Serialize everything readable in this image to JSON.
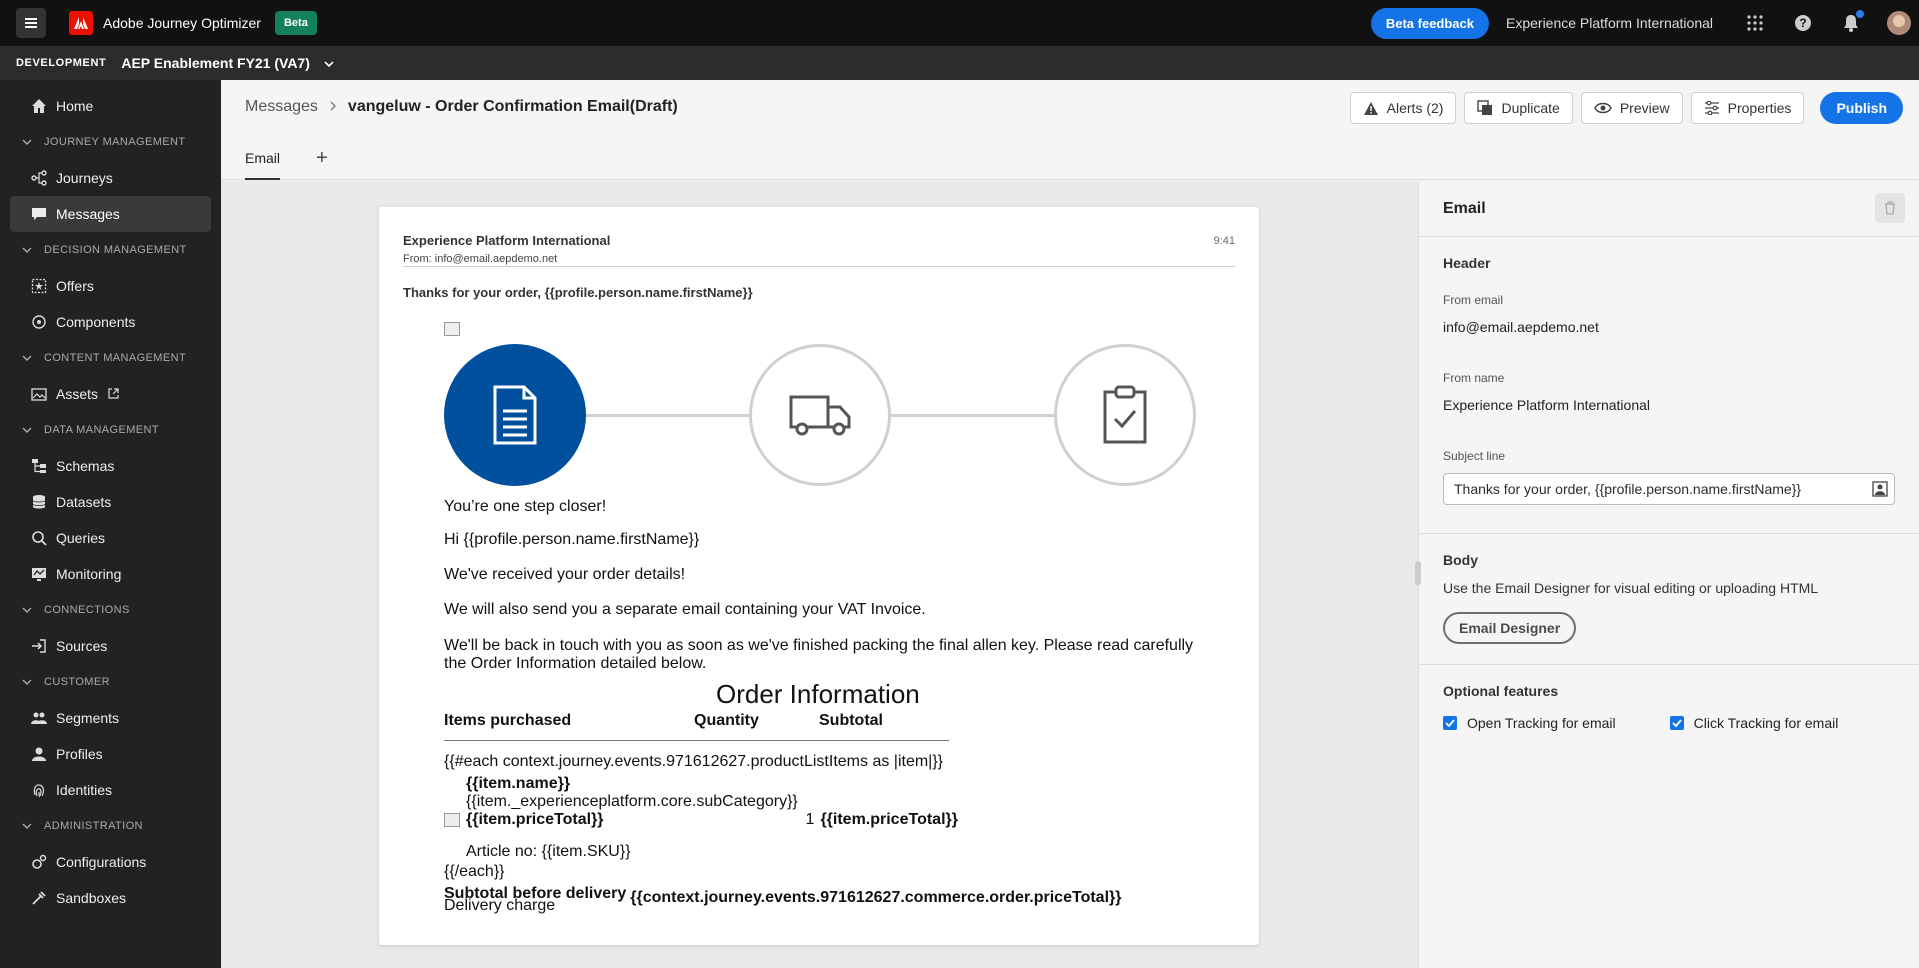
{
  "topbar": {
    "app_title": "Adobe Journey Optimizer",
    "beta_badge": "Beta",
    "feedback_label": "Beta feedback",
    "org_name": "Experience Platform International"
  },
  "sandbox": {
    "env_label": "DEVELOPMENT",
    "name": "AEP Enablement FY21 (VA7)"
  },
  "sidebar": {
    "home": "Home",
    "sec_journey": "JOURNEY MANAGEMENT",
    "journeys": "Journeys",
    "messages": "Messages",
    "sec_decision": "DECISION MANAGEMENT",
    "offers": "Offers",
    "components": "Components",
    "sec_content": "CONTENT MANAGEMENT",
    "assets": "Assets",
    "sec_data": "DATA MANAGEMENT",
    "schemas": "Schemas",
    "datasets": "Datasets",
    "queries": "Queries",
    "monitoring": "Monitoring",
    "sec_connections": "CONNECTIONS",
    "sources": "Sources",
    "sec_customer": "CUSTOMER",
    "segments": "Segments",
    "profiles": "Profiles",
    "identities": "Identities",
    "sec_admin": "ADMINISTRATION",
    "configurations": "Configurations",
    "sandboxes": "Sandboxes"
  },
  "header": {
    "bc_parent": "Messages",
    "bc_current": "vangeluw - Order Confirmation Email(Draft)",
    "alerts": "Alerts (2)",
    "duplicate": "Duplicate",
    "preview": "Preview",
    "properties": "Properties",
    "publish": "Publish",
    "tab_email": "Email",
    "tab_add": "+"
  },
  "email": {
    "sender": "Experience Platform International",
    "from": "From: info@email.aepdemo.net",
    "time": "9:41",
    "subject": "Thanks for your order, {{profile.person.name.firstName}}",
    "p1": "You’re one step closer!",
    "p2": "Hi {{profile.person.name.firstName}}",
    "p3": "We've received your order details!",
    "p4": "We will also send you a separate email containing your VAT Invoice.",
    "p5": "We'll be back in touch with you as soon as we've finished packing the final allen key. Please read carefully the Order Information detailed below.",
    "order_title": "Order Information",
    "col_items": "Items purchased",
    "col_qty": "Quantity",
    "col_subtotal": "Subtotal",
    "each_open": "{{#each context.journey.events.971612627.productListItems as |item|}}",
    "item_name": "{{item.name}}",
    "item_sub": "{{item._experienceplatform.core.subCategory}}",
    "item_price": "{{item.priceTotal}}",
    "item_qty": "1",
    "item_price2": "{{item.priceTotal}}",
    "article": "Article no: {{item.SKU}}",
    "each_close": "{{/each}}",
    "subtotal_label": "Subtotal before delivery",
    "subtotal_value": "{{context.journey.events.971612627.commerce.order.priceTotal}}",
    "delivery": "Delivery charge"
  },
  "panel": {
    "title": "Email",
    "header_title": "Header",
    "from_email_label": "From email",
    "from_email_value": "info@email.aepdemo.net",
    "from_name_label": "From name",
    "from_name_value": "Experience Platform International",
    "subject_label": "Subject line",
    "subject_value": "Thanks for your order, {{profile.person.name.firstName}}",
    "body_title": "Body",
    "body_desc": "Use the Email Designer for visual editing or uploading HTML",
    "designer_btn": "Email Designer",
    "optional_title": "Optional features",
    "open_tracking": "Open Tracking for email",
    "click_tracking": "Click Tracking for email"
  },
  "colors": {
    "accent": "#1473e6",
    "step_active": "#00509e",
    "beta_badge": "#12805c"
  }
}
